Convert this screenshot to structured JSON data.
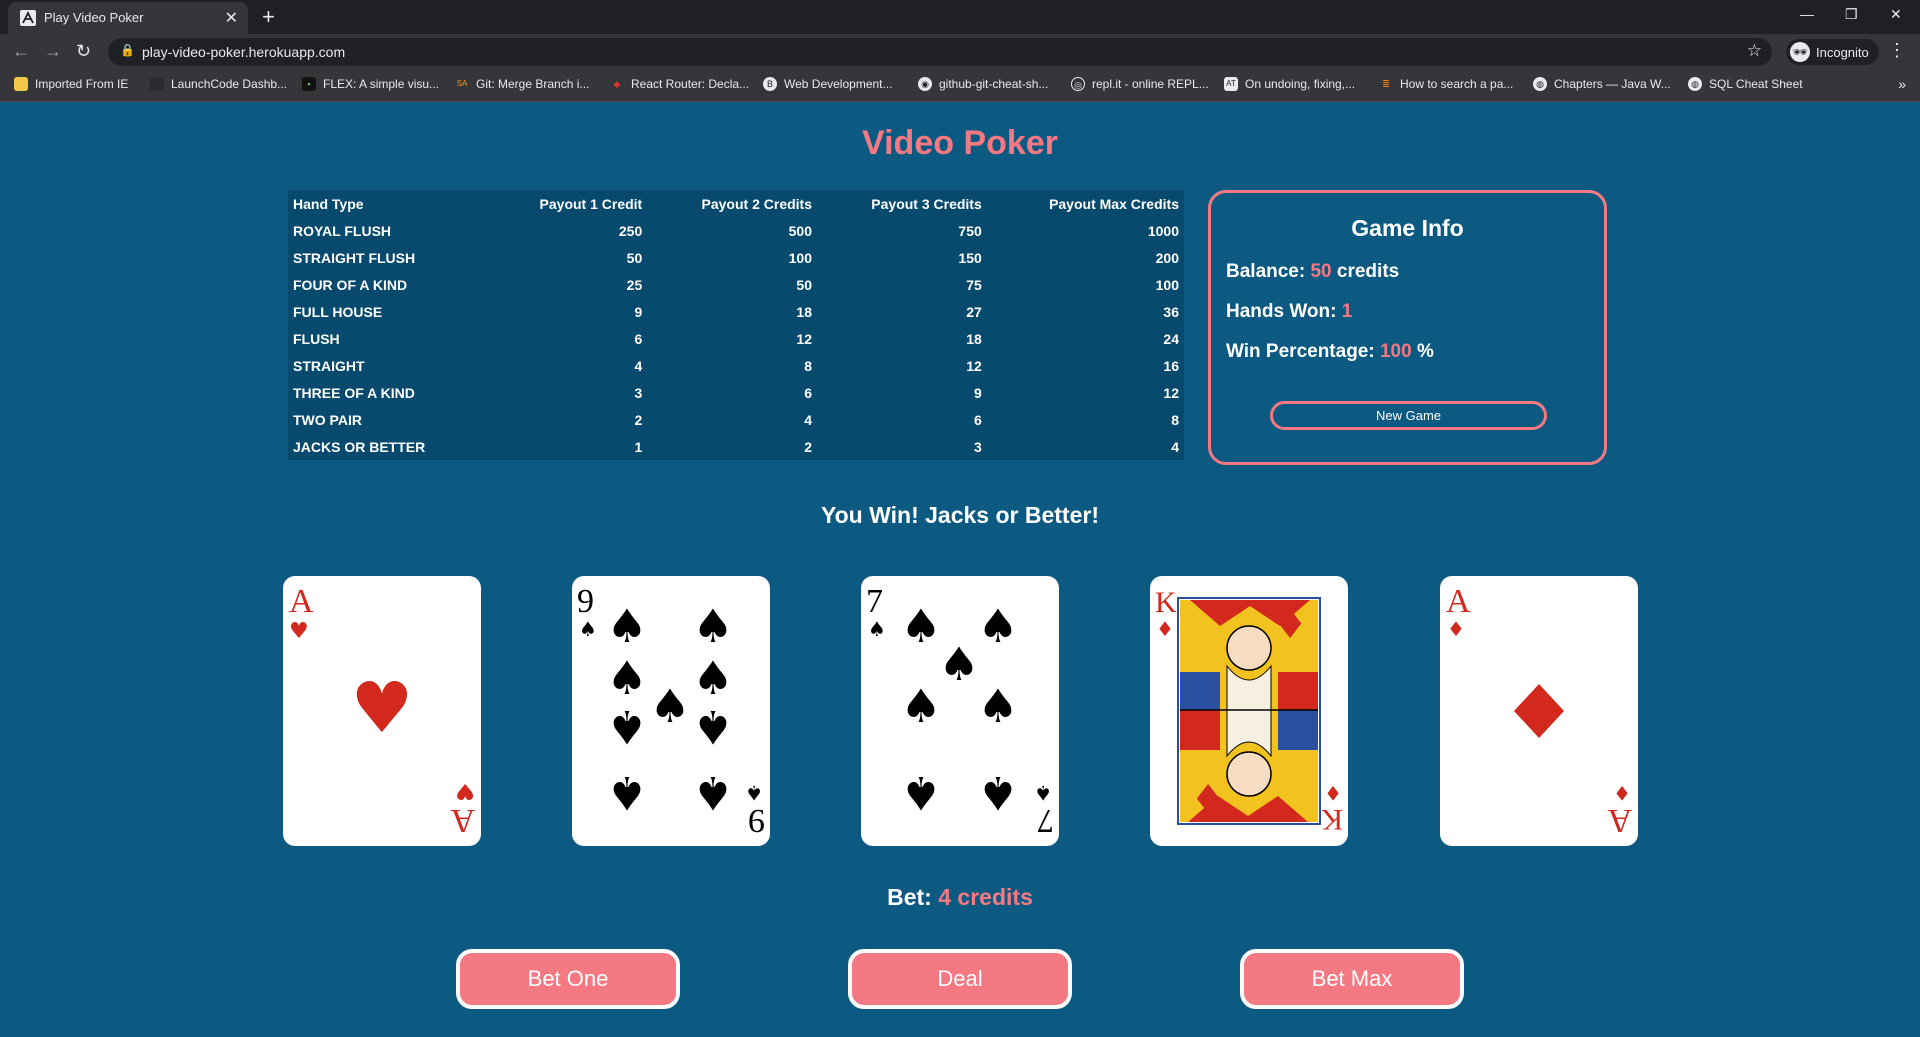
{
  "browser": {
    "tab_title": "Play Video Poker",
    "new_tab": "+",
    "url": "play-video-poker.herokuapp.com",
    "profile": "Incognito",
    "bookmarks": [
      "Imported From IE",
      "LaunchCode Dashb...",
      "FLEX: A simple visu...",
      "Git: Merge Branch i...",
      "React Router: Decla...",
      "Web Development...",
      "github-git-cheat-sh...",
      "repl.it - online REPL...",
      "On undoing, fixing,...",
      "How to search a pa...",
      "Chapters — Java W...",
      "SQL Cheat Sheet"
    ]
  },
  "page": {
    "title": "Video Poker",
    "paytable": {
      "headers": [
        "Hand Type",
        "Payout 1 Credit",
        "Payout 2 Credits",
        "Payout 3 Credits",
        "Payout Max Credits"
      ],
      "rows": [
        [
          "Royal Flush",
          "250",
          "500",
          "750",
          "1000"
        ],
        [
          "Straight Flush",
          "50",
          "100",
          "150",
          "200"
        ],
        [
          "Four of a Kind",
          "25",
          "50",
          "75",
          "100"
        ],
        [
          "Full House",
          "9",
          "18",
          "27",
          "36"
        ],
        [
          "Flush",
          "6",
          "12",
          "18",
          "24"
        ],
        [
          "Straight",
          "4",
          "8",
          "12",
          "16"
        ],
        [
          "Three of a Kind",
          "3",
          "6",
          "9",
          "12"
        ],
        [
          "Two Pair",
          "2",
          "4",
          "6",
          "8"
        ],
        [
          "Jacks or Better",
          "1",
          "2",
          "3",
          "4"
        ]
      ]
    },
    "game_info": {
      "heading": "Game Info",
      "balance_label": "Balance:",
      "balance_value": "50",
      "balance_unit": "credits",
      "hands_won_label": "Hands Won:",
      "hands_won_value": "1",
      "win_pct_label": "Win Percentage:",
      "win_pct_value": "100",
      "win_pct_unit": "%",
      "new_game": "New Game"
    },
    "result": "You Win! Jacks or Better!",
    "cards": [
      {
        "rank": "A",
        "suit": "hearts"
      },
      {
        "rank": "9",
        "suit": "spades"
      },
      {
        "rank": "7",
        "suit": "spades"
      },
      {
        "rank": "K",
        "suit": "diamonds"
      },
      {
        "rank": "A",
        "suit": "diamonds"
      }
    ],
    "bet_label": "Bet:",
    "bet_value": "4 credits",
    "buttons": {
      "bet_one": "Bet One",
      "deal": "Deal",
      "bet_max": "Bet Max"
    }
  },
  "colors": {
    "background": "#0c5a82",
    "accent": "#f47983",
    "red_suit": "#d2281e"
  }
}
